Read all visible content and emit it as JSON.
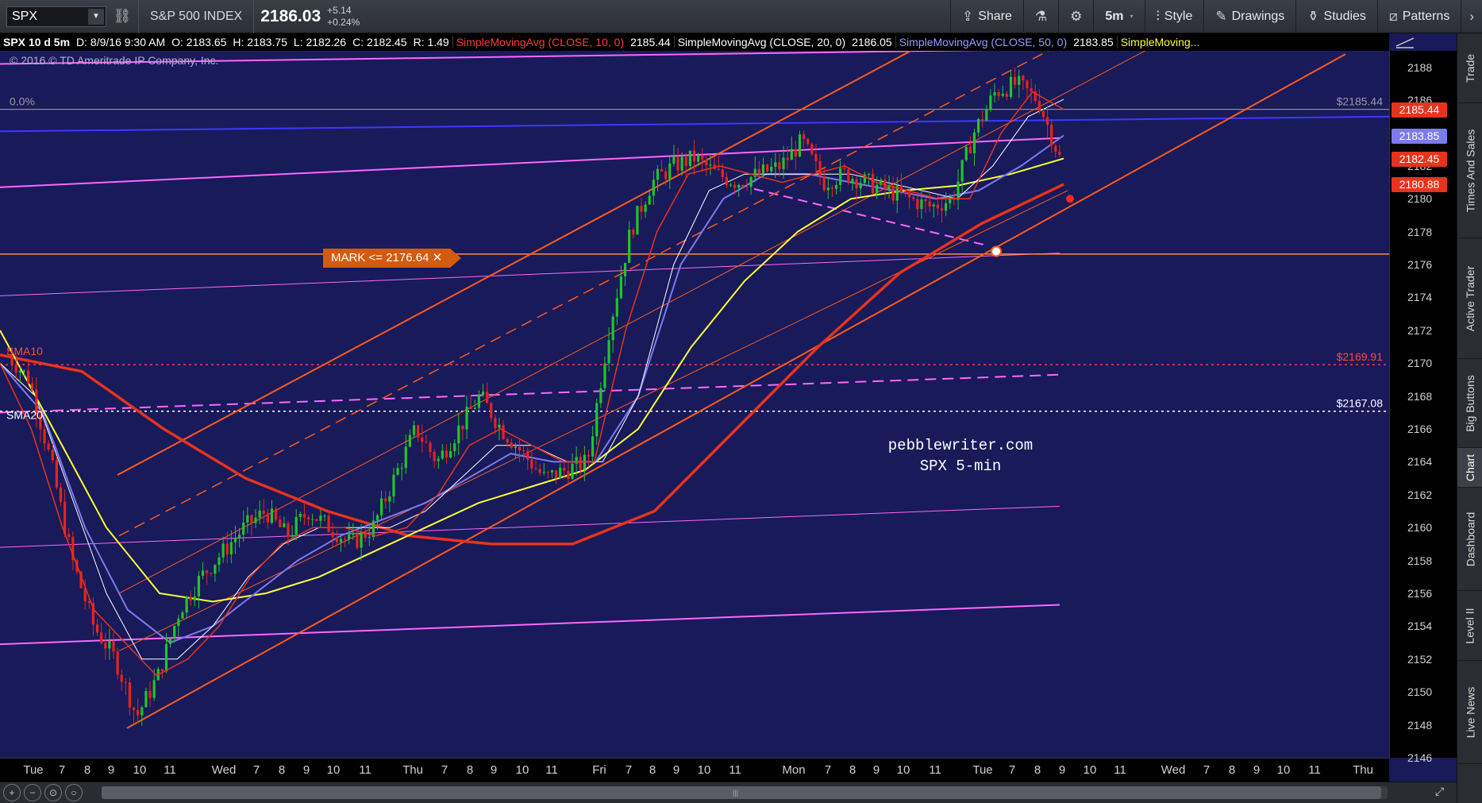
{
  "toolbar": {
    "symbol": "SPX",
    "index_name": "S&P 500 INDEX",
    "price": "2186.03",
    "change": "+5.14",
    "change_pct": "+0.24%",
    "share": "Share",
    "interval": "5m",
    "style": "Style",
    "drawings": "Drawings",
    "studies": "Studies",
    "patterns": "Patterns"
  },
  "study_strip": {
    "symbol": "SPX 10 d 5m",
    "date": "D: 8/9/16 9:30 AM",
    "open": "O: 2183.65",
    "high": "H: 2183.75",
    "low": "L: 2182.26",
    "close": "C: 2182.45",
    "range": "R: 1.49",
    "sma10": "SimpleMovingAvg (CLOSE, 10, 0)",
    "sma10_val": "2185.44",
    "sma20": "SimpleMovingAvg (CLOSE, 20, 0)",
    "sma20_val": "2186.05",
    "sma50": "SimpleMovingAvg (CLOSE, 50, 0)",
    "sma50_val": "2183.85",
    "sma_more": "SimpleMoving..."
  },
  "copyright": "© 2016 © TD Ameritrade IP Company, Inc.",
  "annotations": {
    "fib_zero": "0.0%",
    "level_top": "$2185.44",
    "level_2169": "$2169.91",
    "level_2167": "$2167.08",
    "mark": "MARK <= 2176.64",
    "sma10_tag": "SMA10",
    "sma20_tag": "SMA20",
    "watermark_1": "pebblewriter.com",
    "watermark_2": "SPX 5-min"
  },
  "price_axis": {
    "ticks": [
      "2188",
      "2186",
      "2184",
      "2182",
      "2180",
      "2178",
      "2176",
      "2174",
      "2172",
      "2170",
      "2168",
      "2166",
      "2164",
      "2162",
      "2160",
      "2158",
      "2156",
      "2154",
      "2152",
      "2150",
      "2148",
      "2146"
    ],
    "badges": [
      {
        "label": "2185.44",
        "color": "#e8331c"
      },
      {
        "label": "2183.85",
        "color": "#7b7bf0"
      },
      {
        "label": "2182.45",
        "color": "#e8331c"
      },
      {
        "label": "2180.88",
        "color": "#e8331c"
      }
    ]
  },
  "time_axis": [
    "Tue",
    "7",
    "8",
    "9",
    "10",
    "11",
    "Wed",
    "7",
    "8",
    "9",
    "10",
    "11",
    "Thu",
    "7",
    "8",
    "9",
    "10",
    "11",
    "Fri",
    "7",
    "8",
    "9",
    "10",
    "11",
    "Mon",
    "7",
    "8",
    "9",
    "10",
    "11",
    "Tue",
    "7",
    "8",
    "9",
    "10",
    "11",
    "Wed",
    "7",
    "8",
    "9",
    "10",
    "11",
    "Thu"
  ],
  "side_tabs": [
    "Trade",
    "Times And Sales",
    "Active Trader",
    "Big Buttons",
    "Chart",
    "Dashboard",
    "Level II",
    "Live News"
  ],
  "colors": {
    "background": "#181a5a",
    "sma10": "#e8331c",
    "sma20": "#ffffff",
    "sma50": "#7b7bf0",
    "sma_yellow": "#ffff33",
    "channel": "#ff5a1e",
    "magenta": "#ff66ff"
  },
  "chart_data": {
    "type": "candlestick",
    "symbol": "SPX",
    "ylim": [
      2146,
      2189
    ],
    "y_ticks": [
      2146,
      2148,
      2150,
      2152,
      2154,
      2156,
      2158,
      2160,
      2162,
      2164,
      2166,
      2168,
      2170,
      2172,
      2174,
      2176,
      2178,
      2180,
      2182,
      2184,
      2186,
      2188
    ],
    "x_ticks": [
      "Tue",
      "7",
      "8",
      "9",
      "10",
      "11",
      "Wed",
      "7",
      "8",
      "9",
      "10",
      "11",
      "Thu",
      "7",
      "8",
      "9",
      "10",
      "11",
      "Fri",
      "7",
      "8",
      "9",
      "10",
      "11",
      "Mon",
      "7",
      "8",
      "9",
      "10",
      "11",
      "Tue",
      "7",
      "8",
      "9",
      "10",
      "11",
      "Wed",
      "7",
      "8",
      "9",
      "10",
      "11",
      "Thu"
    ],
    "horizontal_levels": [
      2185.44,
      2169.91,
      2167.08,
      2176.64
    ],
    "close_path": [
      2170.5,
      2169,
      2164,
      2158,
      2154,
      2152,
      2148.5,
      2151,
      2155,
      2157,
      2158.5,
      2160,
      2161,
      2159.5,
      2161,
      2160,
      2159,
      2160,
      2163,
      2166,
      2164,
      2166,
      2168,
      2166,
      2164.5,
      2163,
      2163.5,
      2164,
      2172,
      2178,
      2181,
      2182,
      2182.5,
      2181.5,
      2181,
      2181.5,
      2182,
      2183.5,
      2181,
      2181.5,
      2181,
      2180.5,
      2180,
      2179.5,
      2180,
      2184,
      2186.5,
      2187,
      2186,
      2182.5
    ],
    "sma10": [
      2170,
      2166,
      2160,
      2155,
      2153,
      2151,
      2152,
      2154,
      2157,
      2159,
      2160,
      2160,
      2159.5,
      2160,
      2162,
      2165,
      2166,
      2165,
      2164,
      2164,
      2172,
      2178,
      2181.5,
      2182,
      2181.5,
      2181,
      2181.5,
      2182,
      2181,
      2180.5,
      2180,
      2180,
      2184,
      2186.5,
      2185.44
    ],
    "sma20": [
      2170,
      2168,
      2162,
      2156,
      2152,
      2152,
      2154,
      2157,
      2159,
      2160,
      2160,
      2160,
      2161,
      2163,
      2165,
      2165,
      2164,
      2164,
      2168,
      2176,
      2180.5,
      2181.5,
      2181.5,
      2181.5,
      2181.5,
      2181,
      2180.5,
      2180,
      2182,
      2185,
      2186.05
    ],
    "sma50": [
      2170,
      2167,
      2160,
      2155,
      2153,
      2154,
      2156,
      2158,
      2159.5,
      2160.5,
      2161.5,
      2163,
      2164.5,
      2164,
      2164,
      2168,
      2176,
      2180,
      2181.5,
      2181.5,
      2181,
      2180.5,
      2180,
      2180.5,
      2182,
      2183.85
    ],
    "sma_yellow": [
      2172,
      2166,
      2160,
      2156,
      2155.5,
      2156,
      2157,
      2158.5,
      2160,
      2161.5,
      2162.5,
      2163.5,
      2166,
      2171,
      2175,
      2178,
      2180,
      2180.5,
      2180.8,
      2181.5,
      2182.45
    ],
    "sma_red_long": [
      2170.5,
      2169.5,
      2166,
      2163,
      2161,
      2159.5,
      2159,
      2159,
      2161,
      2166,
      2171,
      2175.5,
      2178.5,
      2180.88
    ]
  }
}
